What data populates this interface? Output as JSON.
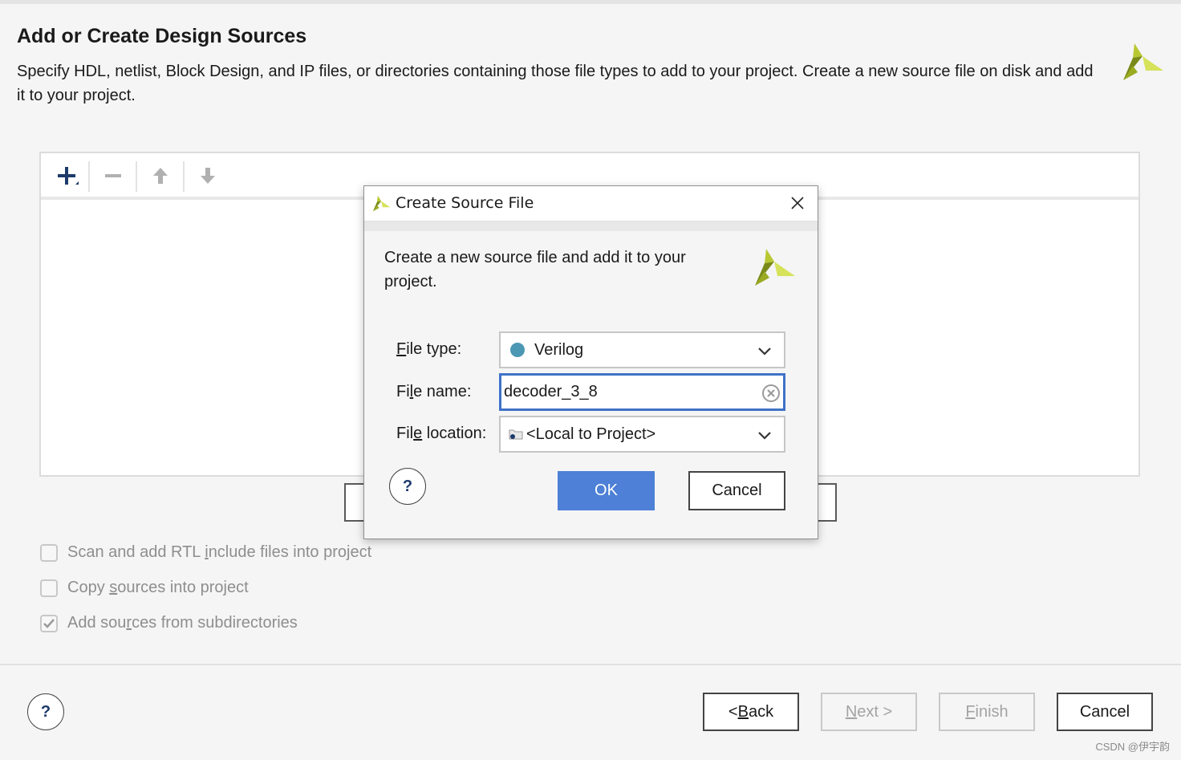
{
  "page": {
    "title": "Add or Create Design Sources",
    "description": "Specify HDL, netlist, Block Design, and IP files, or directories containing those file types to add to your project. Create a new source file on disk and add it to your project."
  },
  "toolbar": {
    "add_icon": "plus-icon",
    "remove_icon": "minus-icon",
    "up_icon": "arrow-up-icon",
    "down_icon": "arrow-down-icon"
  },
  "options": [
    {
      "label_pre": "Scan and add RTL ",
      "label_mn": "i",
      "label_post": "nclude files into project",
      "checked": false
    },
    {
      "label_pre": "Copy ",
      "label_mn": "s",
      "label_post": "ources into project",
      "checked": false
    },
    {
      "label_pre": "Add sou",
      "label_mn": "r",
      "label_post": "ces from subdirectories",
      "checked": true
    }
  ],
  "footer": {
    "help": "?",
    "back_pre": "< ",
    "back_mn": "B",
    "back_post": "ack",
    "next_mn": "N",
    "next_post": "ext >",
    "finish_mn": "F",
    "finish_post": "inish",
    "cancel": "Cancel"
  },
  "dialog": {
    "title": "Create Source File",
    "description": "Create a new source file and add it to your project.",
    "file_type_label_mn": "F",
    "file_type_label_post": "ile type:",
    "file_type_value": "Verilog",
    "file_name_label_pre": "Fi",
    "file_name_label_mn": "l",
    "file_name_label_post": "e name:",
    "file_name_value": "decoder_3_8",
    "file_location_label_pre": "Fil",
    "file_location_label_mn": "e",
    "file_location_label_post": " location:",
    "file_location_value": "<Local to Project>",
    "help": "?",
    "ok": "OK",
    "cancel": "Cancel"
  },
  "watermark": "CSDN @伊宇韵",
  "colors": {
    "accent": "#4d80d6",
    "logo_dark": "#7a8a1a",
    "logo_light": "#d6e25a",
    "verilog_dot": "#4b97b4"
  }
}
